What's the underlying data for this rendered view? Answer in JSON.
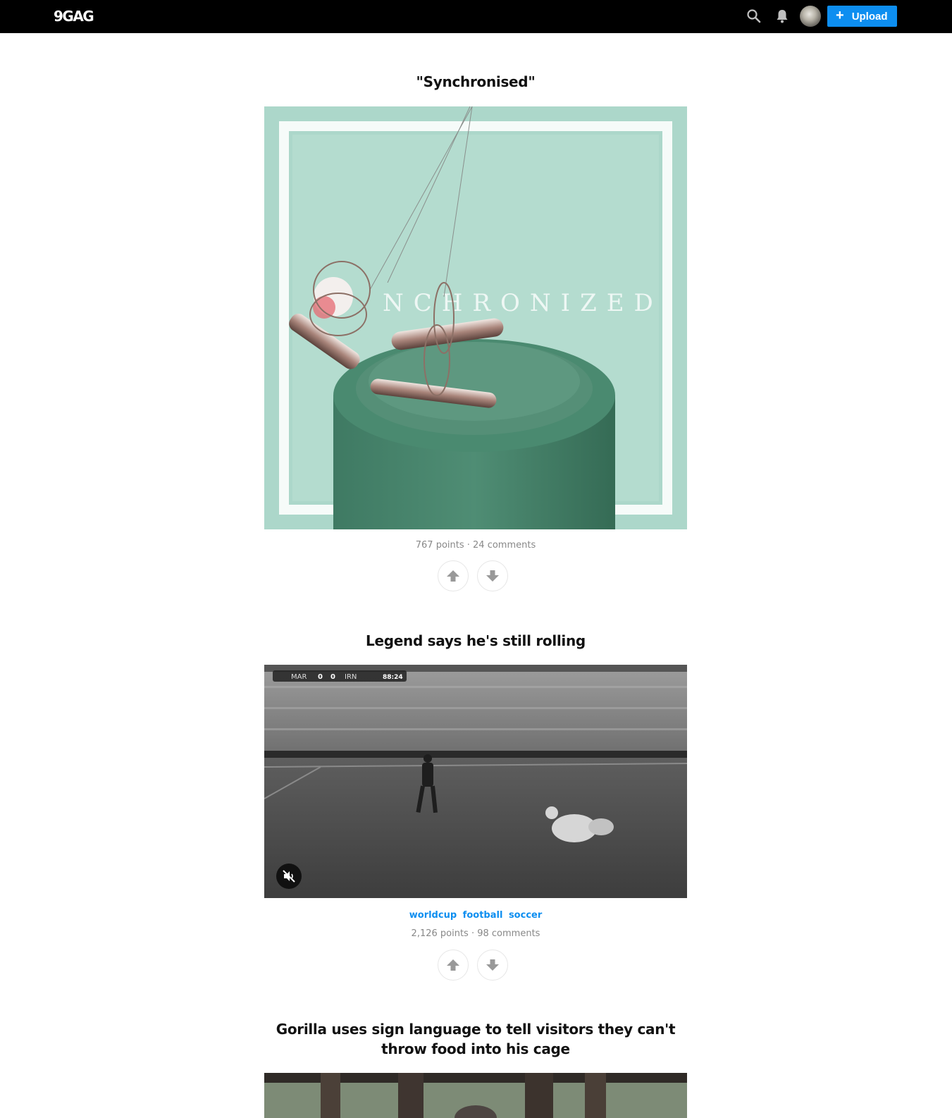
{
  "header": {
    "logo": "9GAG",
    "upload_label": "Upload",
    "icons": [
      "search-icon",
      "bell-icon",
      "plus-icon"
    ],
    "accent_color": "#0d8ef0"
  },
  "posts": [
    {
      "title": "\"Synchronised\"",
      "points": "767 points",
      "comments": "24 comments",
      "media_type": "image",
      "media_text": "NCHRONIZED",
      "tags": []
    },
    {
      "title": "Legend says he's still rolling",
      "points": "2,126 points",
      "comments": "98 comments",
      "media_type": "video",
      "scoreboard": {
        "home": "MAR",
        "home_score": "0",
        "away_score": "0",
        "away": "IRN",
        "clock": "88:24"
      },
      "tags": [
        "worldcup",
        "football",
        "soccer"
      ]
    },
    {
      "title": "Gorilla uses sign language to tell visitors they can't throw food into his cage",
      "media_type": "video"
    }
  ]
}
